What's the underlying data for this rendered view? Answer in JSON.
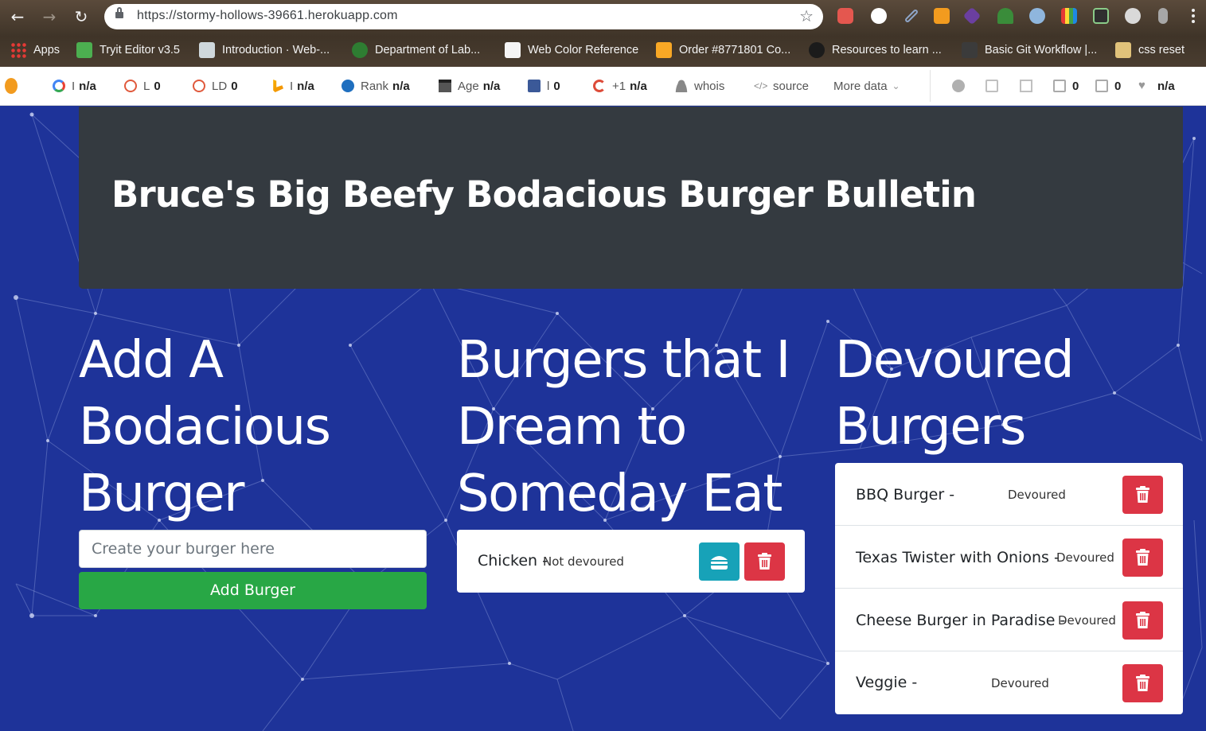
{
  "browser": {
    "url": "https://stormy-hollows-39661.herokuapp.com",
    "bookmarks": [
      {
        "label": "Apps"
      },
      {
        "label": "Tryit Editor v3.5"
      },
      {
        "label": "Introduction · Web-..."
      },
      {
        "label": "Department of Lab..."
      },
      {
        "label": "Web Color Reference"
      },
      {
        "label": "Order #8771801 Co..."
      },
      {
        "label": "Resources to learn ..."
      },
      {
        "label": "Basic Git Workflow |..."
      },
      {
        "label": "css reset"
      }
    ]
  },
  "seo_toolbar": {
    "google_label": "I",
    "google_value": "n/a",
    "l_label": "L",
    "l_value": "0",
    "ld_label": "LD",
    "ld_value": "0",
    "bing_label": "I",
    "bing_value": "n/a",
    "rank_label": "Rank",
    "rank_value": "n/a",
    "age_label": "Age",
    "age_value": "n/a",
    "fb_label": "l",
    "fb_value": "0",
    "gplus_label": "+1",
    "gplus_value": "n/a",
    "whois_label": "whois",
    "source_label": "source",
    "more_label": "More data",
    "ext_links_value": "0",
    "int_links_value": "0",
    "health_value": "n/a"
  },
  "page": {
    "title": "Bruce's Big Beefy Bodacious Burger Bulletin",
    "add_section": {
      "heading_lines": [
        "Add A",
        "Bodacious",
        "Burger"
      ],
      "input_placeholder": "Create your burger here",
      "button_label": "Add Burger"
    },
    "dream_section": {
      "heading_lines": [
        "Burgers that I",
        "Dream to",
        "Someday Eat"
      ],
      "items": [
        {
          "name": "Chicken -",
          "state": "Not devoured"
        }
      ]
    },
    "devoured_section": {
      "heading_lines": [
        "Devoured",
        "Burgers"
      ],
      "items": [
        {
          "name": "BBQ Burger -",
          "state": "Devoured"
        },
        {
          "name": "Texas Twister with Onions -",
          "state": "Devoured"
        },
        {
          "name": "Cheese Burger in Paradise -",
          "state": "Devoured"
        },
        {
          "name": "Veggie -",
          "state": "Devoured"
        }
      ]
    }
  },
  "colors": {
    "page_bg": "#1e3399",
    "jumbotron": "#343a40",
    "success": "#28a745",
    "danger": "#dc3545",
    "info": "#17a2b8"
  }
}
